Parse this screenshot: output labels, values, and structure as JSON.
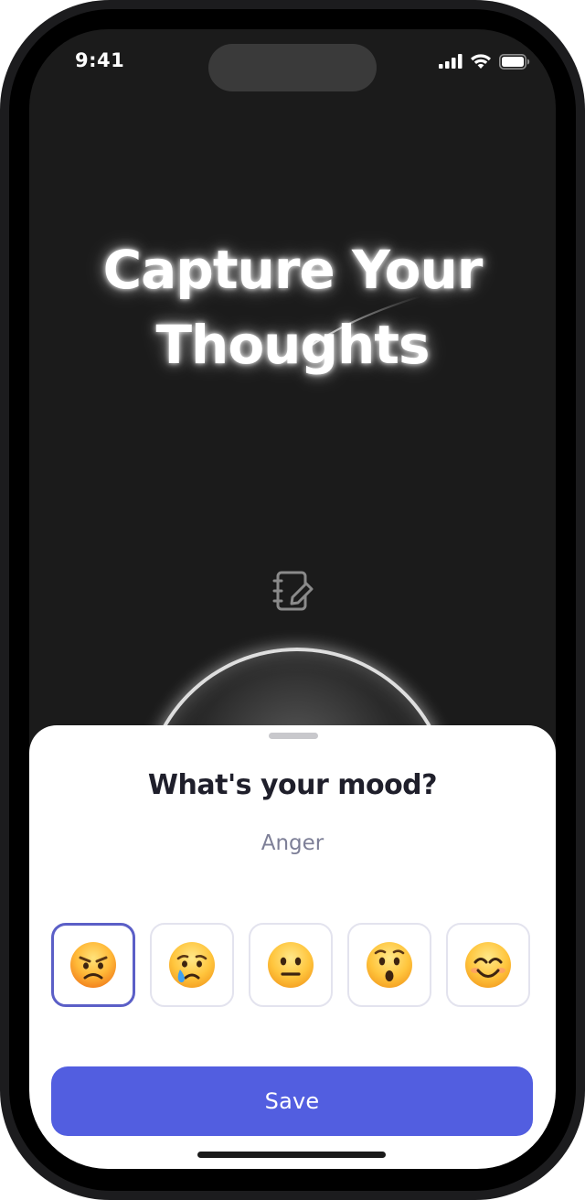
{
  "status_bar": {
    "time": "9:41"
  },
  "hero": {
    "title_line_1": "Capture Your",
    "title_line_2": "Thoughts"
  },
  "sheet": {
    "title": "What's your mood?",
    "selected_mood": "Anger",
    "moods": [
      {
        "name": "anger",
        "selected": true
      },
      {
        "name": "sadness",
        "selected": false
      },
      {
        "name": "neutral",
        "selected": false
      },
      {
        "name": "surprise",
        "selected": false
      },
      {
        "name": "happy",
        "selected": false
      }
    ],
    "save_label": "Save"
  },
  "colors": {
    "screen_bg": "#1b1b1b",
    "accent": "#525ee0",
    "selected_border": "#5b5fc7",
    "title_text": "#1f1f2b",
    "muted_text": "#7d7f97"
  },
  "icons": {
    "journal": "notebook-pen-icon",
    "signal": "cellular-signal-icon",
    "wifi": "wifi-icon",
    "battery": "battery-icon"
  }
}
